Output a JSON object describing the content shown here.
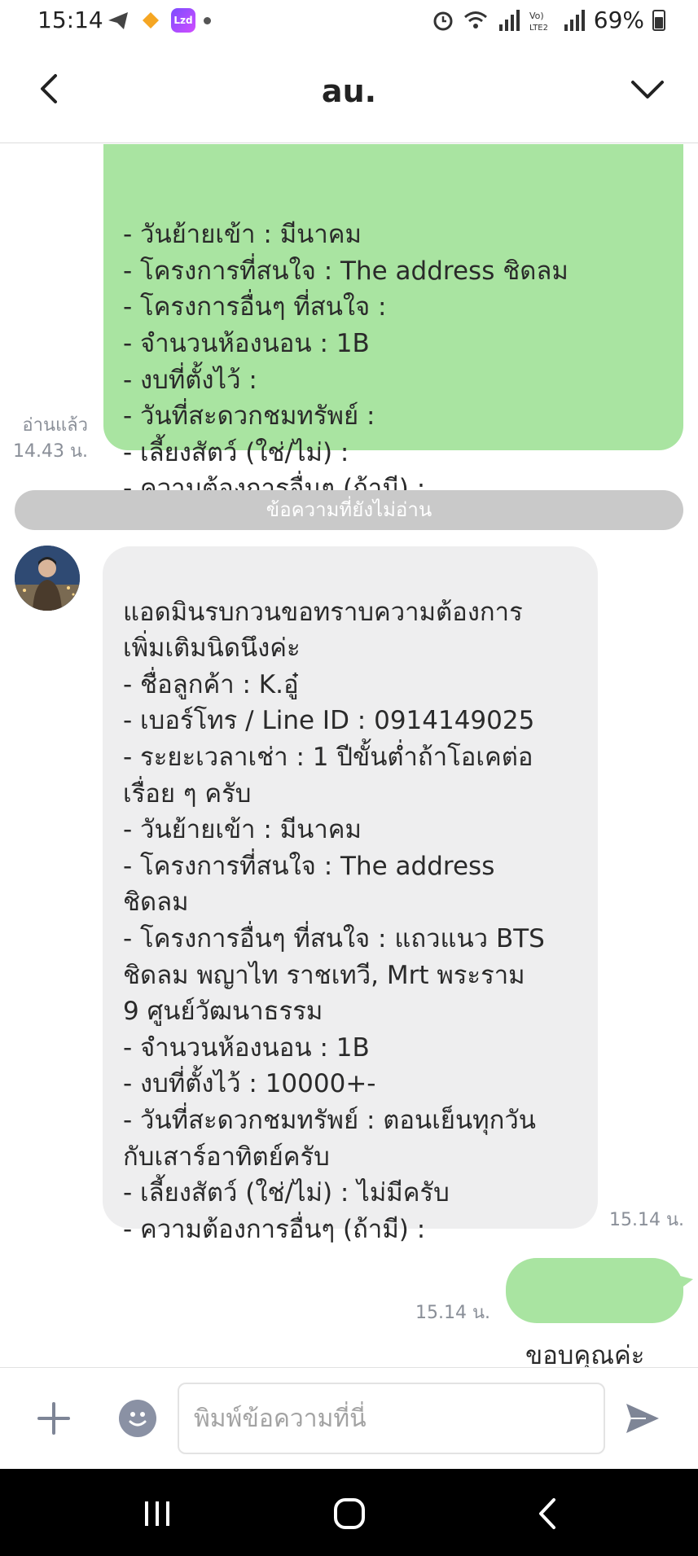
{
  "status_bar": {
    "time": "15:14",
    "battery_text": "69%",
    "app_badge": "Lzd"
  },
  "header": {
    "title": "au."
  },
  "messages": {
    "outgoing_form": {
      "lines": "- วันย้ายเข้า : มีนาคม\n- โครงการที่สนใจ : The address ชิดลม\n- โครงการอื่นๆ ที่สนใจ :\n- จำนวนห้องนอน : 1B\n- งบที่ตั้งไว้ :\n- วันที่สะดวกชมทรัพย์ :\n- เลี้ยงสัตว์ (ใช่/ไม่) :\n- ความต้องการอื่นๆ (ถ้ามี) :",
      "read_label": "อ่านแล้ว",
      "time": "14.43 น."
    },
    "unread_divider": "ข้อความที่ยังไม่อ่าน",
    "incoming_reply": {
      "text": "แอดมินรบกวนขอทราบความต้องการ\nเพิ่มเติมนิดนึงค่ะ\n- ชื่อลูกค้า : K.อู๋\n- เบอร์โทร / Line ID : 0914149025\n- ระยะเวลาเช่า : 1 ปีขั้นต่ำถ้าโอเคต่อ\nเรื่อย ๆ ครับ\n- วันย้ายเข้า : มีนาคม\n- โครงการที่สนใจ : The address\nชิดลม\n- โครงการอื่นๆ ที่สนใจ : แถวแนว BTS\nชิดลม พญาไท ราชเทวี, Mrt พระราม\n9 ศูนย์วัฒนาธรรม\n- จำนวนห้องนอน : 1B\n- งบที่ตั้งไว้ : 10000+-\n- วันที่สะดวกชมทรัพย์ : ตอนเย็นทุกวัน\nกับเสาร์อาทิตย์ครับ\n- เลี้ยงสัตว์ (ใช่/ไม่) : ไม่มีครับ\n- ความต้องการอื่นๆ (ถ้ามี) :",
      "time": "15.14 น."
    },
    "outgoing_thanks": {
      "text": "ขอบคุณค่ะ",
      "time": "15.14 น."
    }
  },
  "input": {
    "placeholder": "พิมพ์ข้อความที่นี่"
  },
  "colors": {
    "outgoing_bubble": "#a9e4a1",
    "incoming_bubble": "#eeeeef",
    "divider": "#c9c9c9"
  },
  "icons": [
    "back-arrow-icon",
    "chevron-down-icon",
    "plus-icon",
    "emoji-icon",
    "send-icon",
    "recents-icon",
    "home-icon",
    "nav-back-icon"
  ]
}
